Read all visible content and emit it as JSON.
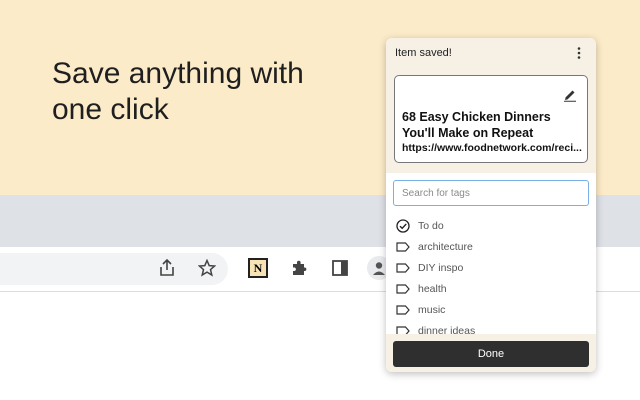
{
  "hero": {
    "line1": "Save anything with",
    "line2": "one click"
  },
  "browser": {
    "icons": [
      "share-icon",
      "bookmark-star-icon",
      "notion-extension-icon",
      "extensions-puzzle-icon",
      "side-panel-icon",
      "profile-icon"
    ],
    "notion_letter": "N"
  },
  "popup": {
    "status": "Item saved!",
    "card": {
      "title": "68 Easy Chicken Dinners You'll Make on Repeat",
      "url": "https://www.foodnetwork.com/reci..."
    },
    "search_placeholder": "Search for tags",
    "tags": [
      {
        "label": "To do",
        "icon": "check-circle-icon"
      },
      {
        "label": "architecture",
        "icon": "tag-icon"
      },
      {
        "label": "DIY inspo",
        "icon": "tag-icon"
      },
      {
        "label": "health",
        "icon": "tag-icon"
      },
      {
        "label": "music",
        "icon": "tag-icon"
      },
      {
        "label": "dinner ideas",
        "icon": "tag-icon"
      }
    ],
    "done_label": "Done"
  },
  "colors": {
    "background": "#fcebc8",
    "popup_header": "#f7f1e5",
    "done_button": "#2f2f2f",
    "search_border": "#7ab0e8"
  }
}
